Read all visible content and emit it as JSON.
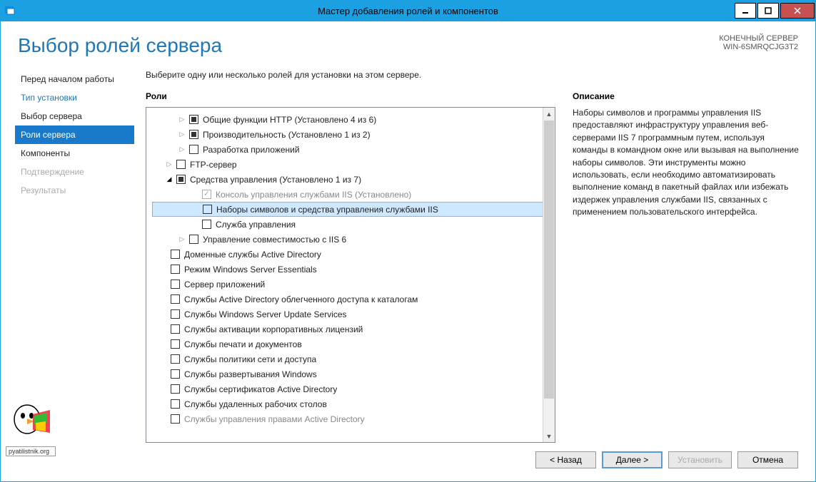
{
  "titlebar": {
    "title": "Мастер добавления ролей и компонентов"
  },
  "header": {
    "page_title": "Выбор ролей сервера",
    "target_label": "КОНЕЧНЫЙ СЕРВЕР",
    "target_name": "WIN-6SMRQCJG3T2"
  },
  "nav": {
    "items": [
      {
        "label": "Перед началом работы",
        "state": "normal"
      },
      {
        "label": "Тип установки",
        "state": "link"
      },
      {
        "label": "Выбор сервера",
        "state": "normal"
      },
      {
        "label": "Роли сервера",
        "state": "active"
      },
      {
        "label": "Компоненты",
        "state": "normal"
      },
      {
        "label": "Подтверждение",
        "state": "disabled"
      },
      {
        "label": "Результаты",
        "state": "disabled"
      }
    ]
  },
  "main": {
    "instruction": "Выберите одну или несколько ролей для установки на этом сервере.",
    "roles_title": "Роли",
    "desc_title": "Описание",
    "description": "Наборы символов и программы управления IIS предоставляют инфраструктуру управления веб-серверами IIS 7 программным путем, используя команды в командном окне или вызывая на выполнение наборы символов. Эти инструменты можно использовать, если необходимо автоматизировать выполнение команд в пакетный файлах или избежать издержек управления службами IIS, связанных с применением пользовательского интерфейса."
  },
  "tree": [
    {
      "indent": 2,
      "expander": "closed",
      "cb": "indeterminate",
      "label": "Общие функции HTTP (Установлено 4 из 6)"
    },
    {
      "indent": 2,
      "expander": "closed",
      "cb": "indeterminate",
      "label": "Производительность (Установлено 1 из 2)"
    },
    {
      "indent": 2,
      "expander": "closed",
      "cb": "unchecked",
      "label": "Разработка приложений"
    },
    {
      "indent": 1,
      "expander": "closed",
      "cb": "unchecked",
      "label": "FTP-сервер"
    },
    {
      "indent": 1,
      "expander": "open",
      "cb": "indeterminate",
      "label": "Средства управления (Установлено 1 из 7)"
    },
    {
      "indent": 3,
      "expander": "none",
      "cb": "checked-disabled",
      "label": "Консоль управления службами IIS (Установлено)",
      "labelDisabled": true
    },
    {
      "indent": 3,
      "expander": "none",
      "cb": "unchecked",
      "label": "Наборы символов и средства управления службами IIS",
      "selected": true
    },
    {
      "indent": 3,
      "expander": "none",
      "cb": "unchecked",
      "label": "Служба управления"
    },
    {
      "indent": 2,
      "expander": "closed",
      "cb": "unchecked",
      "label": "Управление совместимостью с IIS 6"
    },
    {
      "flat": true,
      "cb": "unchecked",
      "label": "Доменные службы Active Directory"
    },
    {
      "flat": true,
      "cb": "unchecked",
      "label": "Режим Windows Server Essentials"
    },
    {
      "flat": true,
      "cb": "unchecked",
      "label": "Сервер приложений"
    },
    {
      "flat": true,
      "cb": "unchecked",
      "label": "Службы Active Directory облегченного доступа к каталогам"
    },
    {
      "flat": true,
      "cb": "unchecked",
      "label": "Службы Windows Server Update Services"
    },
    {
      "flat": true,
      "cb": "unchecked",
      "label": "Службы активации корпоративных лицензий"
    },
    {
      "flat": true,
      "cb": "unchecked",
      "label": "Службы печати и документов"
    },
    {
      "flat": true,
      "cb": "unchecked",
      "label": "Службы политики сети и доступа"
    },
    {
      "flat": true,
      "cb": "unchecked",
      "label": "Службы развертывания Windows"
    },
    {
      "flat": true,
      "cb": "unchecked",
      "label": "Службы сертификатов Active Directory"
    },
    {
      "flat": true,
      "cb": "unchecked",
      "label": "Службы удаленных рабочих столов"
    },
    {
      "flat": true,
      "cb": "unchecked",
      "label": "Службы управления правами Active Directory",
      "labelDisabled": true
    }
  ],
  "footer": {
    "back": "< Назад",
    "next": "Далее >",
    "install": "Установить",
    "cancel": "Отмена"
  },
  "logo": "pyatilistnik.org"
}
